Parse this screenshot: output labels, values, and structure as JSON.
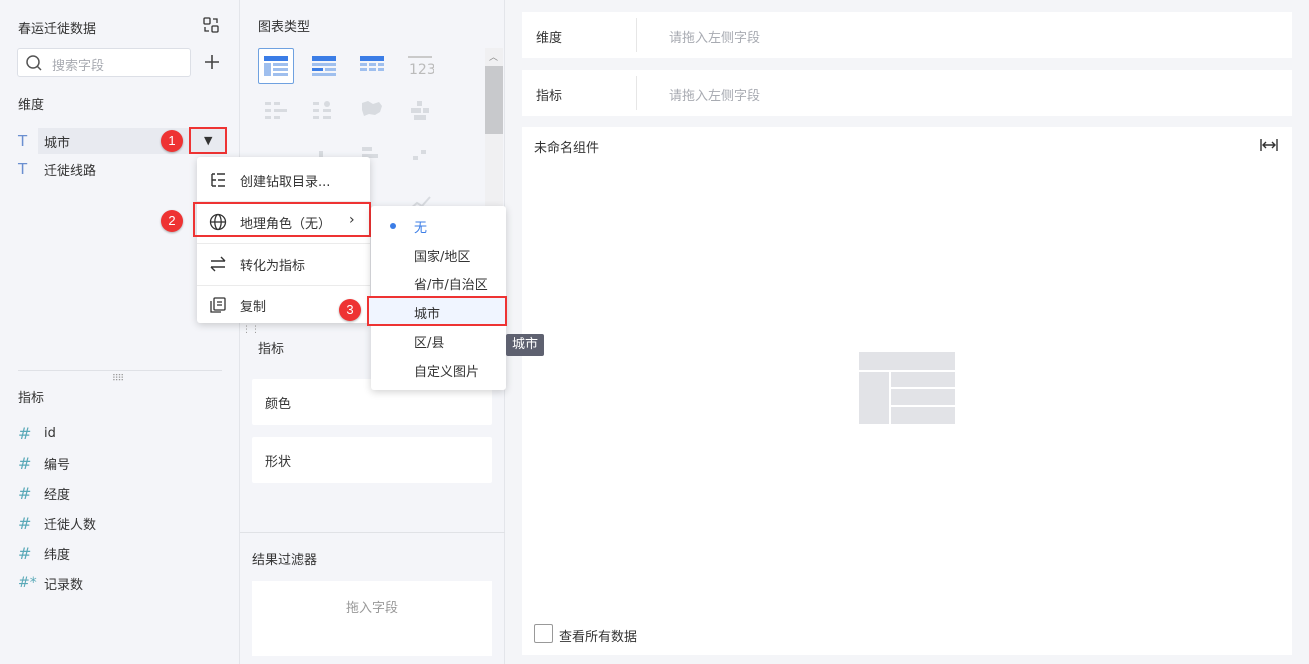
{
  "left": {
    "dataset_title": "春运迁徙数据",
    "search_placeholder": "搜索字段",
    "dimensions_label": "维度",
    "dimensions": [
      {
        "icon": "T",
        "name": "城市"
      },
      {
        "icon": "T",
        "name": "迁徙线路"
      }
    ],
    "metrics_label": "指标",
    "metrics": [
      {
        "icon": "#",
        "name": "id"
      },
      {
        "icon": "#",
        "name": "编号"
      },
      {
        "icon": "#",
        "name": "经度"
      },
      {
        "icon": "#",
        "name": "迁徙人数"
      },
      {
        "icon": "#",
        "name": "纬度"
      },
      {
        "icon": "#*",
        "name": "记录数"
      }
    ]
  },
  "middle": {
    "chart_type_label": "图表类型",
    "metric_label": "指标",
    "color_label": "颜色",
    "shape_label": "形状",
    "filter_label": "结果过滤器",
    "drop_placeholder": "拖入字段"
  },
  "right": {
    "dimension_key": "维度",
    "dimension_placeholder": "请拖入左侧字段",
    "metric_key": "指标",
    "metric_placeholder": "请拖入左侧字段",
    "component_title": "未命名组件",
    "view_all_data": "查看所有数据"
  },
  "context_menu": {
    "items": [
      {
        "label": "创建钻取目录...",
        "icon": "drill-tree-icon"
      },
      {
        "label": "地理角色（无）",
        "icon": "globe-icon",
        "has_submenu": true
      },
      {
        "label": "转化为指标",
        "icon": "convert-icon"
      },
      {
        "label": "复制",
        "icon": "copy-icon"
      }
    ]
  },
  "geo_submenu": {
    "items": [
      "无",
      "国家/地区",
      "省/市/自治区",
      "城市",
      "区/县",
      "自定义图片"
    ],
    "selected": "无",
    "hovered": "城市"
  },
  "tooltip": "城市",
  "badges": [
    "1",
    "2",
    "3"
  ],
  "colors": {
    "highlight_red": "#e33333",
    "accent_blue": "#3b7de6",
    "metric_icon": "#5aa9b8",
    "dimension_icon": "#6a8fd0"
  }
}
